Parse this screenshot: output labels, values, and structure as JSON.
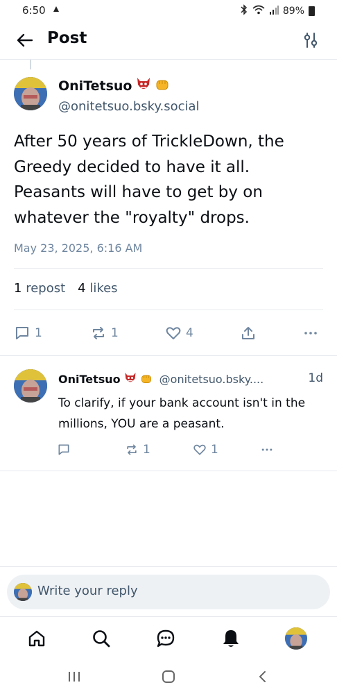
{
  "status_bar": {
    "time": "6:50",
    "notification_icon": "app-icon",
    "battery": "89%"
  },
  "header": {
    "title": "Post",
    "back_icon": "arrow-left-icon",
    "filter_icon": "sliders-icon"
  },
  "post": {
    "author_name": "OniTetsuo",
    "author_emojis": [
      "oni-mask-icon",
      "fist-icon"
    ],
    "handle": "@onitetsuo.bsky.social",
    "text": "After 50 years of TrickleDown, the Greedy decided to have it all. Peasants will have to get by on whatever the \"royalty\" drops.",
    "date": "May 23, 2025, 6:16 AM",
    "stats": {
      "reposts_count": "1",
      "reposts_label": "repost",
      "likes_count": "4",
      "likes_label": "likes"
    },
    "actions": {
      "reply_count": "1",
      "repost_count": "1",
      "like_count": "4"
    }
  },
  "reply": {
    "author_name": "OniTetsuo",
    "handle": "@onitetsuo.bsky....",
    "time": "1d",
    "text": "To clarify, if your bank account isn't in the millions, YOU are a peasant.",
    "actions": {
      "repost_count": "1",
      "like_count": "1"
    }
  },
  "composer": {
    "placeholder": "Write your reply"
  },
  "colors": {
    "text": "#0b0f14",
    "muted": "#6f869f",
    "handle": "#42576c",
    "divider": "#e6e9ee",
    "composer_bg": "#eef1f4"
  }
}
